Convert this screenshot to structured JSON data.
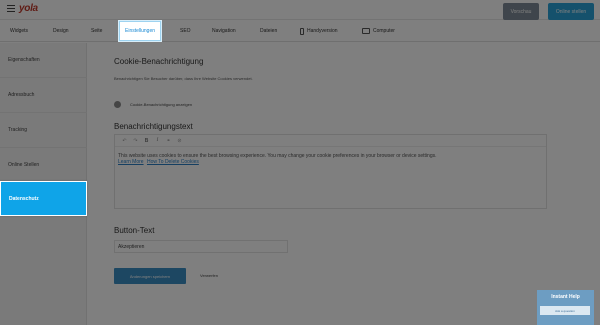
{
  "app": {
    "logo": "yola"
  },
  "topbar": {
    "preview_label": "Vorschau",
    "publish_label": "Online stellen"
  },
  "tabs": [
    "Widgets",
    "Design",
    "Seite",
    "Einstellungen",
    "SEO",
    "Navigation",
    "Dateien",
    "Handyversion",
    "Computer"
  ],
  "sidebar": {
    "items": [
      {
        "label": "Eigenschaften"
      },
      {
        "label": "Adressbuch"
      },
      {
        "label": "Tracking"
      },
      {
        "label": "Online Stellen"
      },
      {
        "label": "Datenschutz"
      }
    ]
  },
  "main": {
    "title": "Cookie-Benachrichtigung",
    "description": "Benachrichtigen Sie Besucher darüber, dass Ihre Website Cookies verwendet.",
    "toggle_label": "Cookie-Benachrichtigung anzeigen",
    "notification_heading": "Benachrichtigungstext",
    "editor_text": "This website uses cookies to ensure the best browsing experience. You may change your cookie preferences in your browser or device settings.",
    "learn_more": "Learn More",
    "how_to_delete": "How To Delete Cookies",
    "button_heading": "Button-Text",
    "button_value": "Akzeptieren",
    "save_label": "Änderungen speichern",
    "cancel_label": "Verwerfen"
  },
  "help": {
    "title": "Instant Help",
    "ask_label": "Ask a question"
  },
  "colors": {
    "accent": "#0fa4e8",
    "publish": "#2aa3d9",
    "save": "#3b8fc4"
  }
}
